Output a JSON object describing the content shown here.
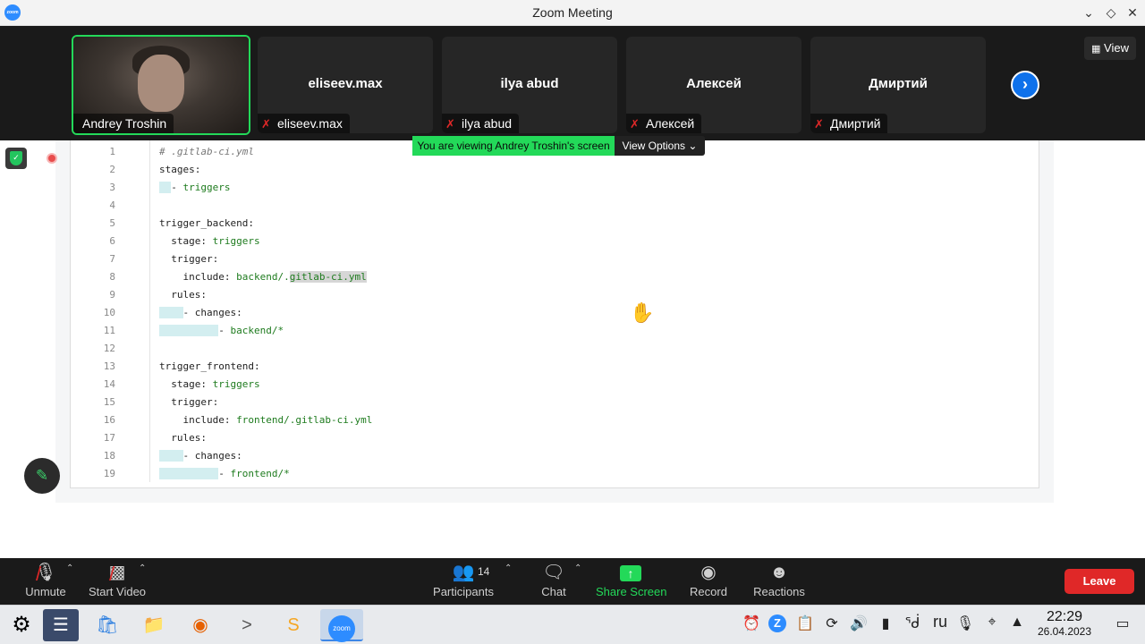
{
  "window": {
    "title": "Zoom Meeting",
    "app_icon_text": "zoom"
  },
  "gallery": {
    "participants": [
      {
        "name": "Andrey Troshin",
        "muted": false,
        "video": true
      },
      {
        "name": "eliseev.max",
        "muted": true,
        "video": false
      },
      {
        "name": "ilya abud",
        "muted": true,
        "video": false
      },
      {
        "name": "Алексей",
        "muted": true,
        "video": false
      },
      {
        "name": "Дмиртий",
        "muted": true,
        "video": false
      }
    ],
    "view_label": "View"
  },
  "share": {
    "banner_text": "You are viewing Andrey Troshin's screen",
    "view_options_label": "View Options",
    "code_lines": [
      {
        "n": "1",
        "code": "# .gitlab-ci.yml"
      },
      {
        "n": "2",
        "code": "stages:"
      },
      {
        "n": "3",
        "code": "  - triggers"
      },
      {
        "n": "4",
        "code": ""
      },
      {
        "n": "5",
        "code": "trigger_backend:"
      },
      {
        "n": "6",
        "code": "  stage: triggers"
      },
      {
        "n": "7",
        "code": "  trigger:"
      },
      {
        "n": "8",
        "code": "    include: backend/.gitlab-ci.yml"
      },
      {
        "n": "9",
        "code": "  rules:"
      },
      {
        "n": "10",
        "code": "    - changes:"
      },
      {
        "n": "11",
        "code": "          - backend/*"
      },
      {
        "n": "12",
        "code": ""
      },
      {
        "n": "13",
        "code": "trigger_frontend:"
      },
      {
        "n": "14",
        "code": "  stage: triggers"
      },
      {
        "n": "15",
        "code": "  trigger:"
      },
      {
        "n": "16",
        "code": "    include: frontend/.gitlab-ci.yml"
      },
      {
        "n": "17",
        "code": "  rules:"
      },
      {
        "n": "18",
        "code": "    - changes:"
      },
      {
        "n": "19",
        "code": "          - frontend/*"
      }
    ]
  },
  "toolbar": {
    "unmute": "Unmute",
    "start_video": "Start Video",
    "participants": "Participants",
    "participants_count": "14",
    "chat": "Chat",
    "share_screen": "Share Screen",
    "record": "Record",
    "reactions": "Reactions",
    "leave": "Leave"
  },
  "taskbar": {
    "keyboard_layout": "ru",
    "time": "22:29",
    "date": "26.04.2023"
  },
  "colors": {
    "accent_green": "#23d959",
    "leave_red": "#e02828",
    "zoom_blue": "#0e71eb"
  }
}
